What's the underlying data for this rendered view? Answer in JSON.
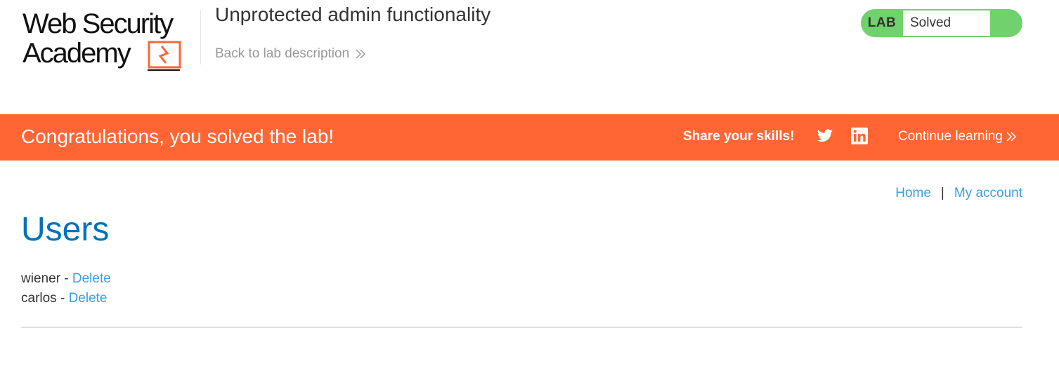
{
  "header": {
    "logo_line1": "Web Security",
    "logo_line2": "Academy",
    "lab_title": "Unprotected admin functionality",
    "back_link": "Back to lab description",
    "lab_badge": "LAB",
    "lab_status": "Solved"
  },
  "banner": {
    "message": "Congratulations, you solved the lab!",
    "share": "Share your skills!",
    "continue": "Continue learning"
  },
  "nav": {
    "home": "Home",
    "separator": "|",
    "account": "My account"
  },
  "main": {
    "heading": "Users",
    "users": [
      {
        "name": "wiener",
        "sep": " - ",
        "action": "Delete"
      },
      {
        "name": "carlos",
        "sep": " - ",
        "action": "Delete"
      }
    ]
  },
  "colors": {
    "banner": "#ff6633",
    "solved": "#70d16d",
    "link": "#3a9fdb",
    "heading": "#0071bc"
  }
}
